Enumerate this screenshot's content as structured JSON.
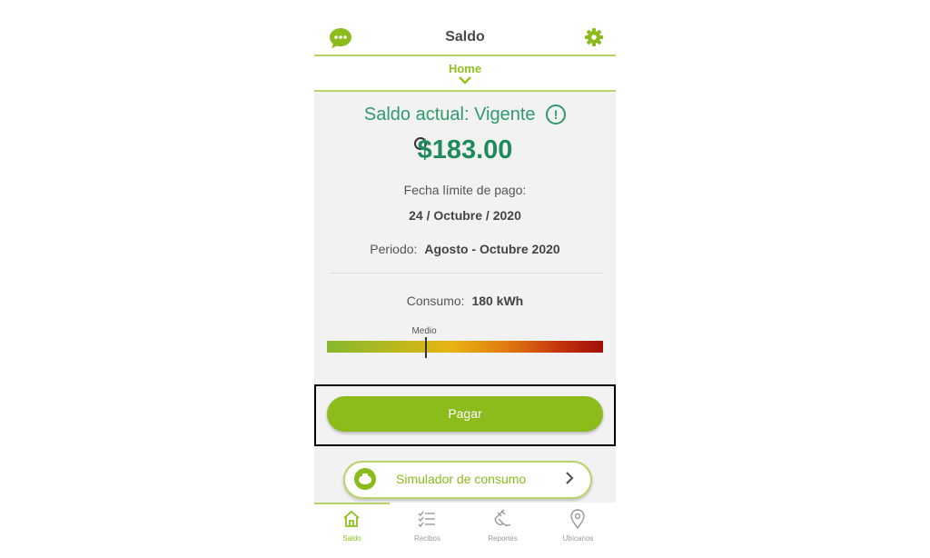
{
  "header": {
    "title": "Saldo",
    "tab_label": "Home"
  },
  "balance": {
    "label": "Saldo actual:",
    "status": "Vigente",
    "info_symbol": "!",
    "amount": "$183.00",
    "due_label": "Fecha límite de pago:",
    "due_date": "24 / Octubre / 2020",
    "period_label": "Periodo:",
    "period_value": "Agosto - Octubre 2020"
  },
  "consumption": {
    "label": "Consumo:",
    "value": "180 kWh",
    "level_label": "Medio",
    "level_fraction": 0.36
  },
  "actions": {
    "pay_label": "Pagar",
    "simulator_label": "Simulador de consumo"
  },
  "bottom_nav": [
    {
      "label": "Saldo",
      "icon": "home-icon",
      "active": true
    },
    {
      "label": "Recibos",
      "icon": "list-icon",
      "active": false
    },
    {
      "label": "Reportes",
      "icon": "plug-icon",
      "active": false
    },
    {
      "label": "Ubícanos",
      "icon": "location-pin-icon",
      "active": false
    }
  ],
  "colors": {
    "accent": "#8cbb1c",
    "balance_text": "#1f8a5e"
  }
}
